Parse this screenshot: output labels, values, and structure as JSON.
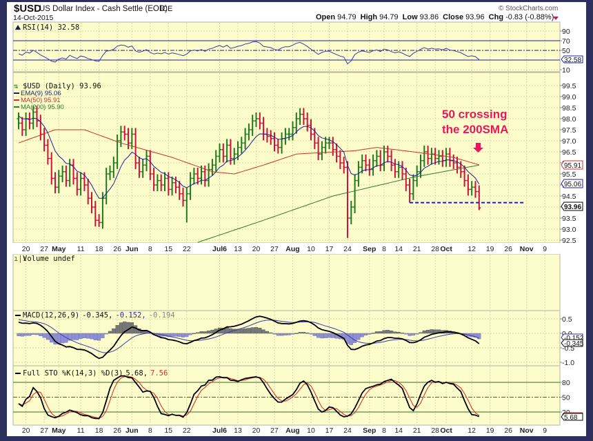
{
  "header": {
    "symbol": "$USD",
    "name": "US Dollar Index - Cash Settle (EOD)",
    "exchange": "ICE",
    "date": "14-Oct-2015",
    "copyright": "© StockCharts.com",
    "open_label": "Open",
    "open": "94.79",
    "high_label": "High",
    "high": "94.79",
    "low_label": "Low",
    "low": "93.86",
    "close_label": "Close",
    "close": "93.96",
    "chg_label": "Chg",
    "chg": "-0.83 (-0.88%)"
  },
  "panels": {
    "rsi": {
      "title": "RSI(14) 32.58",
      "value": "32.58",
      "ticks": [
        "90",
        "70",
        "50",
        "10"
      ]
    },
    "price": {
      "title": "$USD (Daily) 93.96",
      "ema": "EMA(9) 95.06",
      "ma50": "MA(50) 95.91",
      "ma200": "MA(200) 95.90",
      "tags": {
        "ma50": "95.91",
        "ema": "95.06",
        "close": "93.96"
      },
      "ticks": [
        "99.5",
        "99.0",
        "98.5",
        "98.0",
        "97.5",
        "97.0",
        "96.5",
        "96.0",
        "95.5",
        "95.0",
        "94.5",
        "94.0",
        "93.5",
        "93.0",
        "92.5"
      ]
    },
    "volume": {
      "title": "Volume undef"
    },
    "macd": {
      "title": "MACD(12,26,9)",
      "v1": "-0.345,",
      "v2": "-0.152,",
      "v3": "-0.194",
      "tags": {
        "signal": "-0.152",
        "macd": "-0.345"
      },
      "ticks": [
        "0.5",
        "0.0",
        "-0.5",
        "-1.0"
      ]
    },
    "sto": {
      "title": "Full STO %K(14,3) %D(3)",
      "k": "5.68,",
      "d": "7.56",
      "tag": "5.68",
      "ticks": [
        "80",
        "50",
        "20"
      ]
    }
  },
  "annotation": {
    "line1": "50 crossing",
    "line2": "the 200SMA",
    "color": "#e8175d",
    "support_level": 94.2
  },
  "colors": {
    "frame": "#2d2f5e",
    "panel": "#fdfccb",
    "up": "#1f7a1f",
    "down": "#d0103a",
    "ema": "#1c1c9c",
    "ma50": "#c8332e",
    "ma200": "#2e7d2e"
  },
  "chart_data": {
    "type": "line",
    "title": "$USD US Dollar Index - Cash Settle (EOD)",
    "xticks": [
      {
        "label": "20",
        "i": 2
      },
      {
        "label": "27",
        "i": 7
      },
      {
        "label": "May",
        "i": 11,
        "bold": true
      },
      {
        "label": "11",
        "i": 17
      },
      {
        "label": "18",
        "i": 22
      },
      {
        "label": "26",
        "i": 27
      },
      {
        "label": "Jun",
        "i": 31,
        "bold": true
      },
      {
        "label": "8",
        "i": 36
      },
      {
        "label": "15",
        "i": 41
      },
      {
        "label": "22",
        "i": 46
      },
      {
        "label": "Jul6",
        "i": 55,
        "bold": true
      },
      {
        "label": "13",
        "i": 60
      },
      {
        "label": "20",
        "i": 65
      },
      {
        "label": "27",
        "i": 70
      },
      {
        "label": "Aug",
        "i": 75,
        "bold": true
      },
      {
        "label": "10",
        "i": 80
      },
      {
        "label": "17",
        "i": 85
      },
      {
        "label": "24",
        "i": 90
      },
      {
        "label": "Sep",
        "i": 96,
        "bold": true
      },
      {
        "label": "8",
        "i": 100
      },
      {
        "label": "14",
        "i": 104
      },
      {
        "label": "21",
        "i": 109
      },
      {
        "label": "28",
        "i": 114
      },
      {
        "label": "Oct",
        "i": 117,
        "bold": true
      },
      {
        "label": "12",
        "i": 124
      },
      {
        "label": "19",
        "i": 129
      },
      {
        "label": "26",
        "i": 134
      },
      {
        "label": "Nov",
        "i": 139,
        "bold": true
      },
      {
        "label": "9",
        "i": 144
      }
    ],
    "close": [
      97.8,
      97.5,
      98.0,
      97.8,
      98.3,
      97.9,
      97.3,
      96.8,
      96.2,
      95.3,
      94.9,
      95.4,
      95.6,
      95.2,
      95.9,
      95.3,
      94.8,
      95.3,
      95.0,
      94.4,
      94.0,
      93.4,
      93.3,
      94.4,
      95.5,
      95.6,
      96.0,
      97.0,
      97.4,
      97.3,
      96.9,
      97.3,
      96.0,
      95.6,
      95.9,
      96.3,
      95.5,
      95.0,
      95.2,
      95.0,
      95.3,
      94.8,
      95.1,
      94.9,
      94.6,
      94.3,
      94.6,
      95.3,
      95.5,
      95.3,
      95.6,
      95.2,
      95.7,
      95.9,
      96.3,
      96.6,
      96.3,
      96.8,
      96.2,
      96.4,
      96.7,
      96.9,
      97.3,
      97.5,
      97.9,
      98.0,
      97.8,
      97.3,
      97.2,
      97.1,
      96.8,
      96.7,
      97.1,
      97.3,
      97.3,
      97.6,
      98.0,
      98.2,
      98.0,
      97.7,
      97.3,
      96.9,
      96.4,
      96.7,
      96.9,
      96.9,
      96.6,
      96.3,
      96.0,
      95.8,
      93.5,
      94.0,
      95.2,
      95.8,
      96.1,
      95.9,
      95.7,
      96.1,
      96.3,
      95.9,
      96.5,
      96.3,
      95.9,
      95.6,
      95.8,
      95.5,
      95.0,
      94.6,
      95.2,
      95.6,
      96.1,
      96.5,
      96.2,
      96.4,
      96.2,
      96.3,
      96.1,
      96.4,
      96.1,
      96.0,
      95.8,
      95.6,
      95.2,
      94.8,
      94.9,
      94.7,
      93.96
    ],
    "low_overrides": {
      "22": 93.1,
      "46": 93.3,
      "90": 92.6,
      "107": 94.2,
      "126": 93.86
    },
    "ma50": [
      [
        0,
        96.9
      ],
      [
        10,
        97.5
      ],
      [
        18,
        97.5
      ],
      [
        28,
        96.9
      ],
      [
        42,
        96.25
      ],
      [
        53,
        95.6
      ],
      [
        59,
        95.5
      ],
      [
        67,
        95.9
      ],
      [
        76,
        96.4
      ],
      [
        87,
        96.5
      ],
      [
        92,
        96.55
      ],
      [
        98,
        96.7
      ],
      [
        108,
        96.5
      ],
      [
        119,
        96.25
      ],
      [
        126,
        95.91
      ]
    ],
    "ma200": [
      [
        49,
        92.4
      ],
      [
        67,
        93.4
      ],
      [
        86,
        94.5
      ],
      [
        108,
        95.35
      ],
      [
        126,
        95.9
      ]
    ],
    "ylim_price": [
      92.3,
      99.7
    ]
  }
}
